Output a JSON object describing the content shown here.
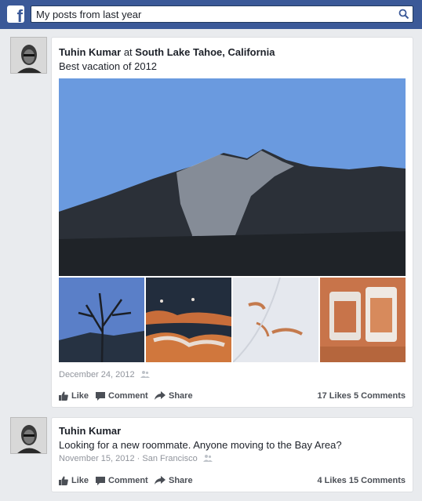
{
  "search": {
    "value": "My posts from last year"
  },
  "posts": [
    {
      "author": "Tuhin Kumar",
      "at_word": "at",
      "place": "South Lake Tahoe, California",
      "text": "Best vacation of 2012",
      "date": "December 24, 2012",
      "actions": {
        "like": "Like",
        "comment": "Comment",
        "share": "Share"
      },
      "counts": "17 Likes 5 Comments"
    },
    {
      "author": "Tuhin Kumar",
      "text": "Looking for a new roommate. Anyone moving to the Bay Area?",
      "date": "November 15, 2012 · San Francisco",
      "actions": {
        "like": "Like",
        "comment": "Comment",
        "share": "Share"
      },
      "counts": "4 Likes 15 Comments"
    }
  ],
  "colors": {
    "brand": "#3b5998",
    "page_bg": "#e9ebee",
    "meta": "#90949c"
  },
  "icons": [
    "facebook-logo-icon",
    "search-icon",
    "like-icon",
    "comment-icon",
    "share-icon",
    "audience-icon"
  ]
}
